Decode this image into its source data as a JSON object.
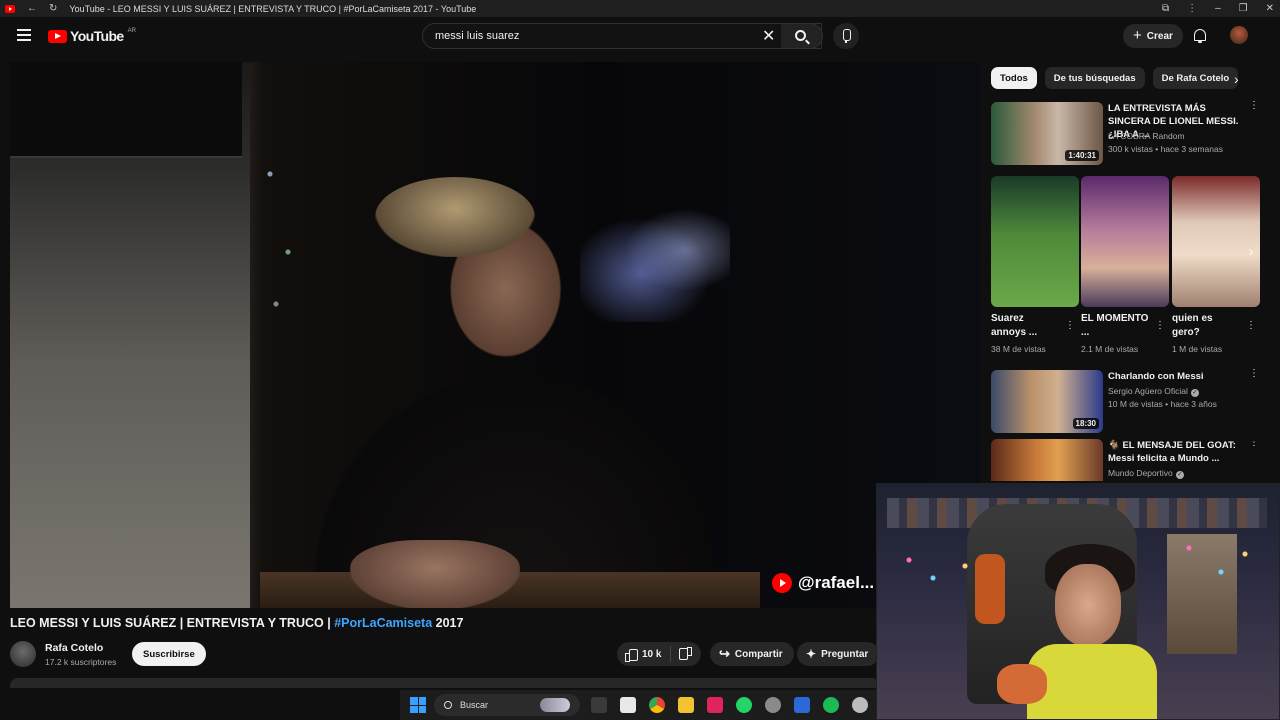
{
  "window": {
    "title": "YouTube - LEO MESSI Y LUIS SUÁREZ | ENTREVISTA Y TRUCO | #PorLaCamiseta 2017 - YouTube"
  },
  "masthead": {
    "logo_text": "YouTube",
    "country_code": "AR",
    "search_value": "messi luis suarez",
    "create_label": "Crear"
  },
  "player": {
    "watermark": "@rafael..."
  },
  "video": {
    "title_main": "LEO MESSI Y LUIS SUÁREZ | ENTREVISTA Y TRUCO | ",
    "title_hashtag": "#PorLaCamiseta",
    "title_year": " 2017",
    "channel_name": "Rafa Cotelo",
    "subscribers": "17.2 k suscriptores",
    "subscribe_label": "Suscribirse",
    "likes": "10 k",
    "share_label": "Compartir",
    "ask_label": "Preguntar"
  },
  "sidebar": {
    "chips": [
      "Todos",
      "De tus búsquedas",
      "De Rafa Cotelo"
    ],
    "recs": [
      {
        "title": "LA ENTREVISTA MÁS SINCERA DE LIONEL MESSI. ¿IBA A ...",
        "channel": "LA COBRA Random",
        "meta": "300 k vistas • hace 3 semanas",
        "duration": "1:40:31"
      },
      {
        "title": "Charlando con Messi",
        "channel": "Sergio Agüero Oficial",
        "meta": "10 M de vistas • hace 3 años",
        "duration": "18:30"
      },
      {
        "title": "🐐 EL MENSAJE DEL GOAT: Messi felicita a Mundo ...",
        "channel": "Mundo Deportivo",
        "meta": "",
        "duration": ""
      }
    ],
    "shorts": [
      {
        "title": "Suarez annoys ...",
        "views": "38 M de vistas"
      },
      {
        "title": "EL MOMENTO ...",
        "views": "2.1 M de vistas"
      },
      {
        "title": "quien es gero?",
        "views": "1 M de vistas"
      }
    ]
  },
  "taskbar": {
    "search_label": "Buscar"
  }
}
